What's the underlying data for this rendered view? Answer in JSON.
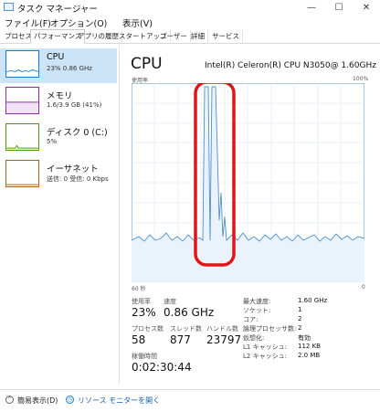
{
  "window": {
    "title": "タスク マネージャー",
    "min": "—",
    "max": "☐",
    "close": "✕"
  },
  "menu": [
    "ファイル(F)",
    "オプション(O)",
    "表示(V)"
  ],
  "tabs": [
    "プロセス",
    "パフォーマンス",
    "アプリの履歴",
    "スタートアップ",
    "ユーザー",
    "詳細",
    "サービス"
  ],
  "active_tab": "パフォーマンス",
  "sidebar": {
    "items": [
      {
        "name": "CPU",
        "sub": "23%  0.86 GHz",
        "color": "#1a7bd1"
      },
      {
        "name": "メモリ",
        "sub": "1.6/3.9 GB (41%)",
        "color": "#8b2fa0"
      },
      {
        "name": "ディスク 0 (C:)",
        "sub": "5%",
        "color": "#4c9a12"
      },
      {
        "name": "イーサネット",
        "sub": "送信: 0  受信: 0 Kbps",
        "color": "#a6621e"
      }
    ]
  },
  "cpu": {
    "title": "CPU",
    "model": "Intel(R) Celeron(R) CPU N3050@ 1.60GHz",
    "graph_label_left": "使用率",
    "graph_label_right": "100%",
    "graph_bottom_left": "60 秒",
    "graph_bottom_right": "0",
    "usage_label": "使用率",
    "usage_value": "23%",
    "speed_label": "速度",
    "speed_value": "0.86 GHz",
    "processes_label": "プロセス数",
    "processes_value": "58",
    "threads_label": "スレッド数",
    "threads_value": "877",
    "handles_label": "ハンドル数",
    "handles_value": "23797",
    "uptime_label": "稼働時間",
    "uptime_value": "0:02:30:44",
    "details": [
      {
        "k": "最大速度:",
        "v": "1.60 GHz"
      },
      {
        "k": "ソケット:",
        "v": "1"
      },
      {
        "k": "コア:",
        "v": "2"
      },
      {
        "k": "論理プロセッサ数:",
        "v": "2"
      },
      {
        "k": "仮想化:",
        "v": "有効"
      },
      {
        "k": "L1 キャッシュ:",
        "v": "112 KB"
      },
      {
        "k": "L2 キャッシュ:",
        "v": "2.0 MB"
      }
    ]
  },
  "bottom": {
    "collapse": "簡易表示(D)",
    "monitor": "リソース モニターを開く"
  },
  "colors": {
    "accent": "#1a7bd1",
    "graph_line": "#4f8fc9",
    "graph_fill": "#eaf3fb",
    "graph_grid": "#d9e8f4",
    "highlight": "#e0151b"
  }
}
